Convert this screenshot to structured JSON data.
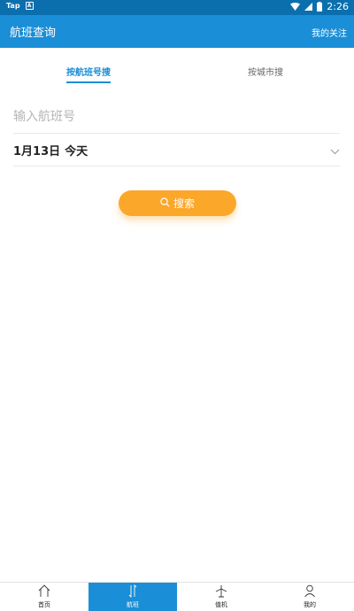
{
  "status_bar": {
    "app_label": "Tap",
    "time": "2:26",
    "battery_icon": "battery-icon",
    "signal_icon": "signal-icon",
    "wifi_icon": "wifi-icon"
  },
  "app_bar": {
    "title": "航班查询",
    "follow_label": "我的关注"
  },
  "tabs": [
    {
      "label": "按航班号搜",
      "active": true
    },
    {
      "label": "按城市搜",
      "active": false
    }
  ],
  "form": {
    "flight_placeholder": "输入航班号",
    "flight_value": "",
    "date": "1月13日",
    "date_suffix": "今天"
  },
  "search_button": {
    "label": "搜索",
    "icon": "search-icon"
  },
  "bottom_nav": [
    {
      "label": "首页",
      "icon": "home-icon",
      "active": false
    },
    {
      "label": "航班",
      "icon": "flight-icon",
      "active": true
    },
    {
      "label": "值机",
      "icon": "checkin-icon",
      "active": false
    },
    {
      "label": "我的",
      "icon": "user-icon",
      "active": false
    }
  ],
  "colors": {
    "primary": "#1a8ed6",
    "status_bar": "#0b6fae",
    "accent": "#fba72a"
  }
}
